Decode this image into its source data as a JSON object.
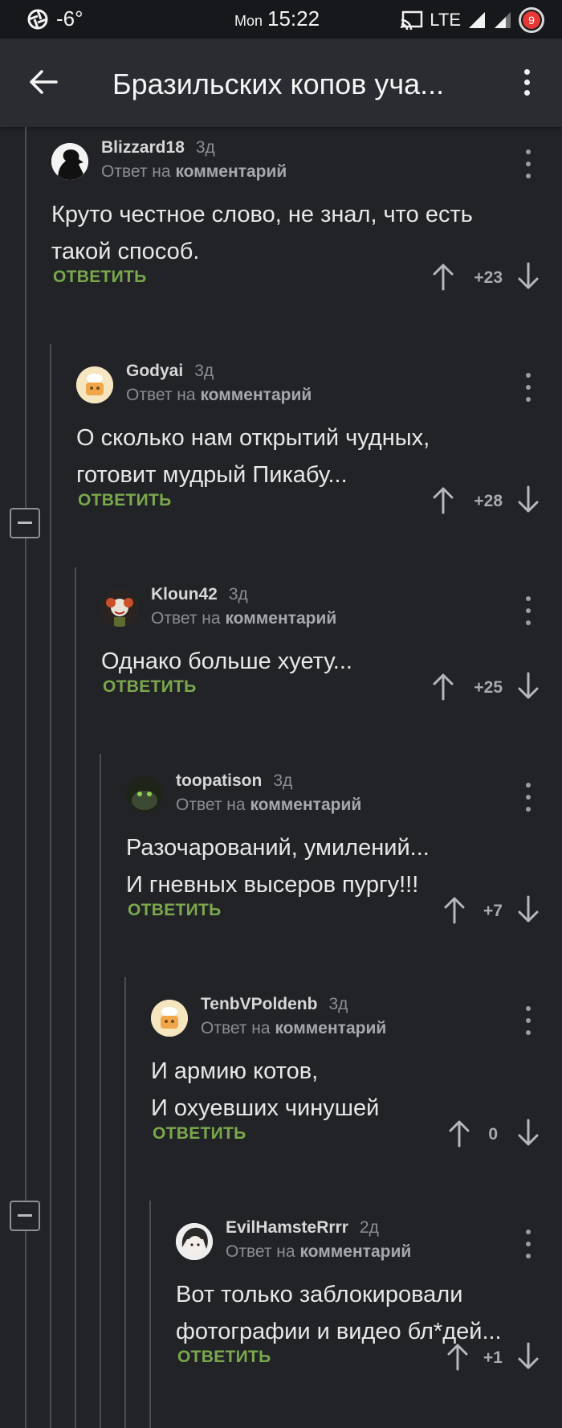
{
  "status_bar": {
    "temperature": "-6°",
    "day": "Mon",
    "time": "15:22",
    "network": "LTE",
    "notification_count": "9"
  },
  "app_bar": {
    "title": "Бразильских копов уча...",
    "back_icon": "arrow-left-icon",
    "menu_icon": "more-vertical-icon"
  },
  "colors": {
    "background": "#212327",
    "reply_green": "#7ba84c",
    "thread_line": "#4a4d53"
  },
  "comments": [
    {
      "author": "Blizzard18",
      "age": "3д",
      "reply_prefix": "Ответ на",
      "reply_target": "комментарий",
      "line1": "Круто честное слово, не знал, что есть",
      "line2": "такой способ.",
      "reply_label": "ОТВЕТИТЬ",
      "rating": "+23"
    },
    {
      "author": "Godyai",
      "age": "3д",
      "reply_prefix": "Ответ на",
      "reply_target": "комментарий",
      "line1": "О сколько нам открытий чудных,",
      "line2": "готовит мудрый Пикабу...",
      "reply_label": "ОТВЕТИТЬ",
      "rating": "+28"
    },
    {
      "author": "Kloun42",
      "age": "3д",
      "reply_prefix": "Ответ на",
      "reply_target": "комментарий",
      "line1": "Однако больше хуету...",
      "line2": "",
      "reply_label": "ОТВЕТИТЬ",
      "rating": "+25"
    },
    {
      "author": "toopatison",
      "age": "3д",
      "reply_prefix": "Ответ на",
      "reply_target": "комментарий",
      "line1": "Разочарований, умилений...",
      "line2": "И гневных высеров пургу!!!",
      "reply_label": "ОТВЕТИТЬ",
      "rating": "+7"
    },
    {
      "author": "TenbVPoldenb",
      "age": "3д",
      "reply_prefix": "Ответ на",
      "reply_target": "комментарий",
      "line1": "И армию котов,",
      "line2": "И охуевших чинушей",
      "reply_label": "ОТВЕТИТЬ",
      "rating": "0"
    },
    {
      "author": "EvilHamsteRrrr",
      "age": "2д",
      "reply_prefix": "Ответ на",
      "reply_target": "комментарий",
      "line1": "Вот только заблокировали",
      "line2": "фотографии и видео бл*дей...",
      "reply_label": "ОТВЕТИТЬ",
      "rating": "+1"
    }
  ]
}
